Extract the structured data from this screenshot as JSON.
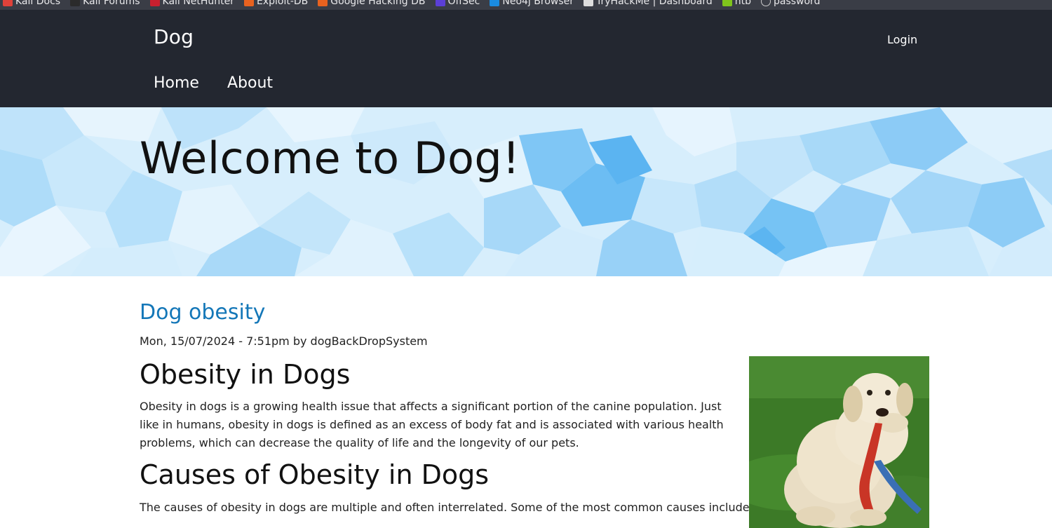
{
  "bookmarks": [
    {
      "label": "Kali Docs",
      "icon": "kali-docs-icon",
      "color": "#e0423a"
    },
    {
      "label": "Kali Forums",
      "icon": "kali-forums-icon",
      "color": "#2b2b2b"
    },
    {
      "label": "Kali NetHunter",
      "icon": "kali-nethunter-icon",
      "color": "#c9202f"
    },
    {
      "label": "Exploit-DB",
      "icon": "exploit-db-icon",
      "color": "#e8621f"
    },
    {
      "label": "Google Hacking DB",
      "icon": "google-hacking-db-icon",
      "color": "#e8621f"
    },
    {
      "label": "OffSec",
      "icon": "offsec-icon",
      "color": "#5b3fd6"
    },
    {
      "label": "Neo4j Browser",
      "icon": "neo4j-icon",
      "color": "#1a8be0"
    },
    {
      "label": "TryHackMe | Dashboard",
      "icon": "tryhackme-icon",
      "color": "#dddddd"
    },
    {
      "label": "htb",
      "icon": "htb-icon",
      "color": "#7fc41c"
    },
    {
      "label": "password",
      "icon": "globe-icon",
      "color": "#cccccc"
    }
  ],
  "header": {
    "site_name": "Dog",
    "login": "Login",
    "nav": [
      "Home",
      "About"
    ],
    "bg_color": "#232730"
  },
  "hero": {
    "title": "Welcome to Dog!"
  },
  "post": {
    "title": "Dog obesity",
    "meta": "Mon, 15/07/2024 - 7:51pm by dogBackDropSystem",
    "heading1": "Obesity in Dogs",
    "paragraph1": "Obesity in dogs is a growing health issue that affects a significant portion of the canine population. Just like in humans, obesity in dogs is defined as an excess of body fat and is associated with various health problems, which can decrease the quality of life and the longevity of our pets.",
    "heading2": "Causes of Obesity in Dogs",
    "paragraph2": "The causes of obesity in dogs are multiple and often interrelated. Some of the most common causes include:",
    "image_subject": "overweight yellow labrador holding red leash on grass",
    "link_color": "#1477b8"
  }
}
